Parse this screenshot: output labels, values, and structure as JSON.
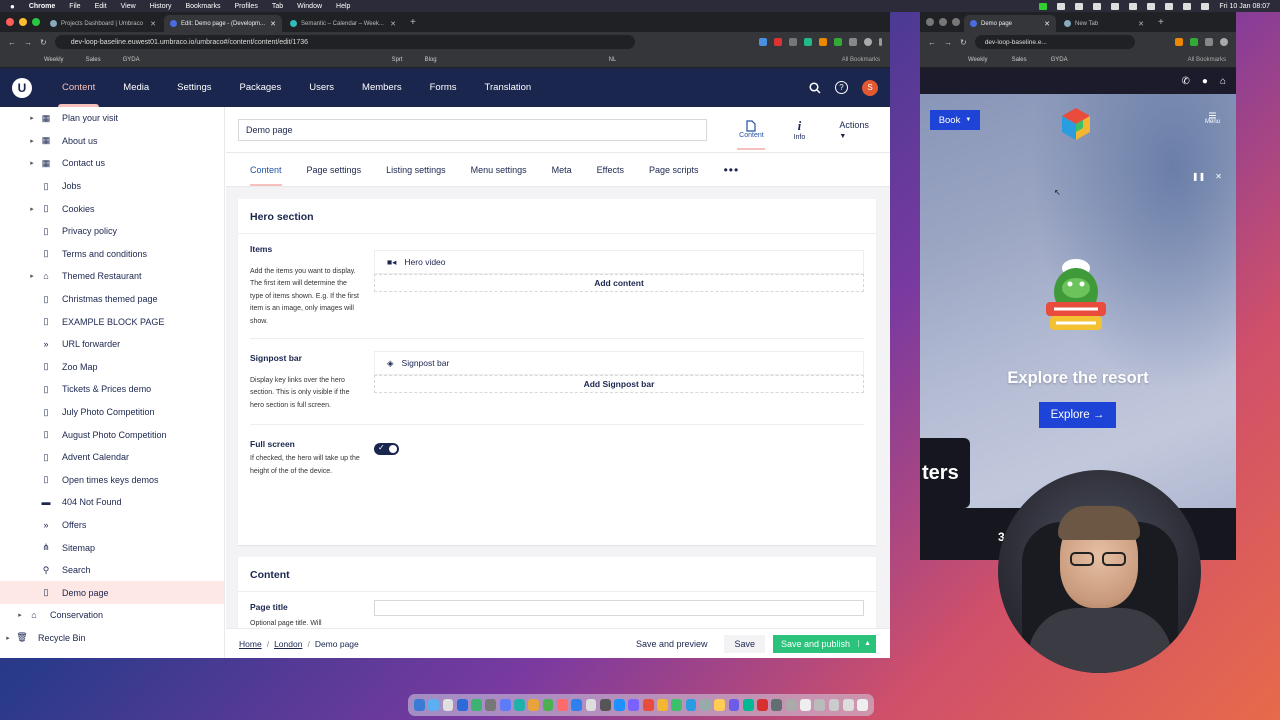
{
  "menubar": {
    "app": "Chrome",
    "items": [
      "File",
      "Edit",
      "View",
      "History",
      "Bookmarks",
      "Profiles",
      "Tab",
      "Window",
      "Help"
    ],
    "clock": "Fri 10 Jan 08:07"
  },
  "main_window": {
    "tabs": [
      {
        "label": "Projects Dashboard | Umbraco"
      },
      {
        "label": "Edit: Demo page - (Developm..."
      },
      {
        "label": "Semantic – Calendar – Week..."
      }
    ],
    "url": "dev-loop-baseline.euwest01.umbraco.io/umbraco#/content/content/edit/1736",
    "bookmarks": [
      "Weekly",
      "Sales",
      "GYDA"
    ],
    "bookmarks_more": [
      "Sprt",
      "Blog",
      "NL"
    ],
    "all_bookmarks": "All Bookmarks"
  },
  "umbraco": {
    "logo": "U",
    "nav": [
      "Content",
      "Media",
      "Settings",
      "Packages",
      "Users",
      "Members",
      "Forms",
      "Translation"
    ],
    "avatar_initial": "S",
    "help": "?"
  },
  "tree": {
    "items": [
      {
        "label": "Plan your visit",
        "icon": "grid-icon",
        "expand": true,
        "level": 1
      },
      {
        "label": "About us",
        "icon": "grid-icon",
        "expand": true,
        "level": 1
      },
      {
        "label": "Contact us",
        "icon": "grid-icon",
        "expand": true,
        "level": 1
      },
      {
        "label": "Jobs",
        "icon": "document-icon",
        "expand": false,
        "level": 1
      },
      {
        "label": "Cookies",
        "icon": "document-icon",
        "expand": true,
        "level": 1
      },
      {
        "label": "Privacy policy",
        "icon": "document-icon",
        "expand": false,
        "level": 1
      },
      {
        "label": "Terms and conditions",
        "icon": "document-icon",
        "expand": false,
        "level": 1
      },
      {
        "label": "Themed Restaurant",
        "icon": "home-icon",
        "expand": true,
        "level": 1
      },
      {
        "label": "Christmas themed page",
        "icon": "document-icon",
        "expand": false,
        "level": 1
      },
      {
        "label": "EXAMPLE BLOCK PAGE",
        "icon": "document-icon",
        "expand": false,
        "level": 1
      },
      {
        "label": "URL forwarder",
        "icon": "forward-icon",
        "expand": false,
        "level": 1
      },
      {
        "label": "Zoo Map",
        "icon": "document-icon",
        "expand": false,
        "level": 1
      },
      {
        "label": "Tickets & Prices demo",
        "icon": "document-icon",
        "expand": false,
        "level": 1
      },
      {
        "label": "July Photo Competition",
        "icon": "document-icon",
        "expand": false,
        "level": 1
      },
      {
        "label": "August Photo Competition",
        "icon": "document-icon",
        "expand": false,
        "level": 1
      },
      {
        "label": "Advent Calendar",
        "icon": "document-icon",
        "expand": false,
        "level": 1
      },
      {
        "label": "Open times keys demos",
        "icon": "document-icon",
        "expand": false,
        "level": 1
      },
      {
        "label": "404 Not Found",
        "icon": "window-icon",
        "expand": false,
        "level": 1
      },
      {
        "label": "Offers",
        "icon": "forward-icon",
        "expand": false,
        "level": 1
      },
      {
        "label": "Sitemap",
        "icon": "sitemap-icon",
        "expand": false,
        "level": 1
      },
      {
        "label": "Search",
        "icon": "search-icon",
        "expand": false,
        "level": 1
      },
      {
        "label": "Demo page",
        "icon": "document-icon",
        "expand": false,
        "level": 1,
        "selected": true
      },
      {
        "label": "Conservation",
        "icon": "home-icon",
        "expand": true,
        "level": 0
      },
      {
        "label": "Recycle Bin",
        "icon": "trash-icon",
        "expand": true,
        "level": -1
      }
    ]
  },
  "editor": {
    "page_name": "Demo page",
    "apps": [
      {
        "label": "Content",
        "icon": "document-icon"
      },
      {
        "label": "Info",
        "icon": "info-icon"
      }
    ],
    "actions": "Actions",
    "tabs": [
      "Content",
      "Page settings",
      "Listing settings",
      "Menu settings",
      "Meta",
      "Effects",
      "Page scripts"
    ],
    "hero": {
      "title": "Hero section",
      "items_label": "Items",
      "items_desc": "Add the items you want to display. The first item will determine the type of items shown. E.g. If the first item is an image, only images will show.",
      "items_block": "Hero video",
      "items_add": "Add content",
      "signpost_label": "Signpost bar",
      "signpost_desc": "Display key links over the hero section. This is only visible if the hero section is full screen.",
      "signpost_block": "Signpost bar",
      "signpost_add": "Add Signpost bar",
      "fullscreen_label": "Full screen",
      "fullscreen_desc": "If checked, the hero will take up the height of the of the device.",
      "fullscreen_on": true
    },
    "content": {
      "title": "Content",
      "page_title_label": "Page title",
      "page_title_desc": "Optional page title. Will"
    },
    "breadcrumb": [
      "Home",
      "London",
      "Demo page"
    ],
    "buttons": {
      "preview": "Save and preview",
      "save": "Save",
      "publish": "Save and publish"
    }
  },
  "second_window": {
    "tabs": [
      {
        "label": "Demo page"
      },
      {
        "label": "New Tab"
      }
    ],
    "url": "dev-loop-baseline.e...",
    "bookmarks": [
      "Weekly",
      "Sales",
      "GYDA"
    ],
    "all_bookmarks": "All Bookmarks",
    "site": {
      "book": "Book",
      "menu": "Menu",
      "heading": "Explore the resort",
      "explore": "Explore",
      "signpost_text": "ters",
      "count": "3("
    }
  },
  "colors": {
    "umbraco_navy": "#1b264f",
    "umbraco_pink": "#f5c1bc",
    "publish_green": "#2bc37c",
    "site_blue": "#1d44d6"
  }
}
